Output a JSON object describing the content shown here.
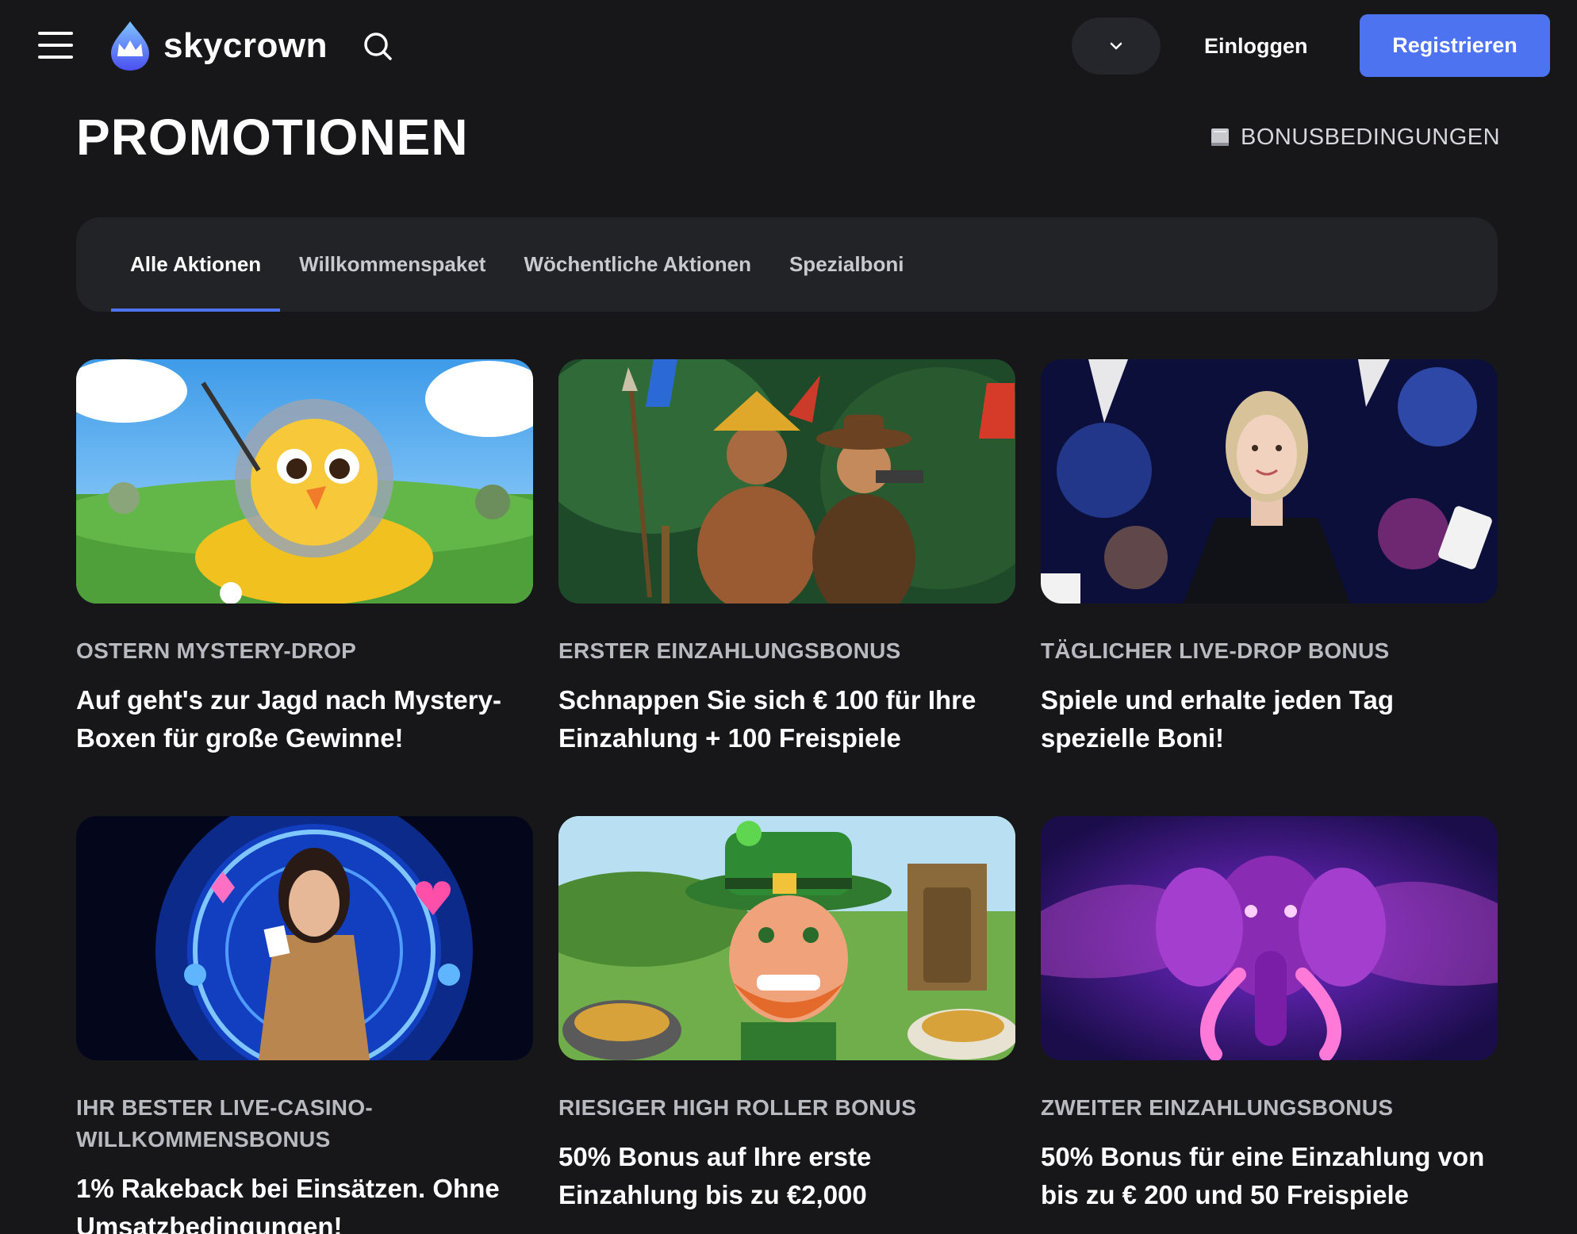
{
  "header": {
    "logo_text": "skycrown",
    "login_label": "Einloggen",
    "register_label": "Registrieren",
    "accent_color": "#4e73f0"
  },
  "page": {
    "title": "PROMOTIONEN",
    "terms_label": "BONUSBEDINGUNGEN"
  },
  "tabs": [
    {
      "label": "Alle Aktionen",
      "active": true
    },
    {
      "label": "Willkommenspaket",
      "active": false
    },
    {
      "label": "Wöchentliche Aktionen",
      "active": false
    },
    {
      "label": "Spezialboni",
      "active": false
    }
  ],
  "promotions": [
    {
      "category": "OSTERN MYSTERY-DROP",
      "title": "Auf geht's zur Jagd nach Mystery-Boxen für große Gewinne!",
      "image": "chick-astronaut"
    },
    {
      "category": "ERSTER EINZAHLUNGSBONUS",
      "title": "Schnappen Sie sich € 100 für Ihre Einzahlung + 100 Freispiele",
      "image": "jungle-explorers"
    },
    {
      "category": "TÄGLICHER LIVE-DROP BONUS",
      "title": "Spiele und erhalte jeden Tag spezielle Boni!",
      "image": "live-dealer"
    },
    {
      "category": "IHR BESTER LIVE-CASINO-WILLKOMMENSBONUS",
      "title": "1% Rakeback bei Einsätzen. Ohne Umsatzbedingungen!",
      "image": "portal-dealer"
    },
    {
      "category": "RIESIGER HIGH ROLLER BONUS",
      "title": "50% Bonus auf Ihre erste Einzahlung bis zu €2,000",
      "image": "leprechaun"
    },
    {
      "category": "ZWEITER EINZAHLUNGSBONUS",
      "title": "50% Bonus für eine Einzahlung von bis zu € 200 und 50 Freispiele",
      "image": "neon-elephant"
    }
  ]
}
